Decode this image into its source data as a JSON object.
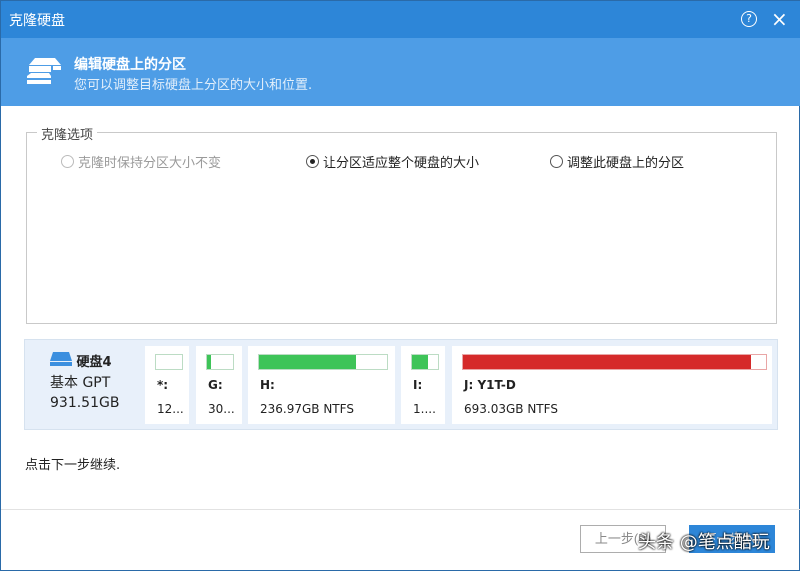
{
  "window": {
    "title": "克隆硬盘",
    "help": "?",
    "close": "×"
  },
  "header": {
    "title": "编辑硬盘上的分区",
    "subtitle": "您可以调整目标硬盘上分区的大小和位置."
  },
  "options": {
    "legend": "克隆选项",
    "items": [
      {
        "label": "克隆时保持分区大小不变",
        "selected": false,
        "disabled": true
      },
      {
        "label": "让分区适应整个硬盘的大小",
        "selected": true,
        "disabled": false
      },
      {
        "label": "调整此硬盘上的分区",
        "selected": false,
        "disabled": false
      }
    ]
  },
  "disk": {
    "name": "硬盘4",
    "type": "基本 GPT",
    "size": "931.51GB",
    "partitions": [
      {
        "letter": "*:",
        "info": "12...",
        "used": 0
      },
      {
        "letter": "G:",
        "info": "30...",
        "used": 0.15
      },
      {
        "letter": "H:",
        "info": "236.97GB NTFS",
        "used": 0.76
      },
      {
        "letter": "I:",
        "info": "1....",
        "used": 0.6
      },
      {
        "letter": "J: Y1T-D",
        "info": "693.03GB NTFS",
        "used": 0.95,
        "color": "#d52a2a"
      }
    ]
  },
  "hint": "点击下一步继续.",
  "buttons": {
    "back": "上一步(B)",
    "next": "下一步(N)"
  },
  "watermark": "头条 @笔点酷玩"
}
